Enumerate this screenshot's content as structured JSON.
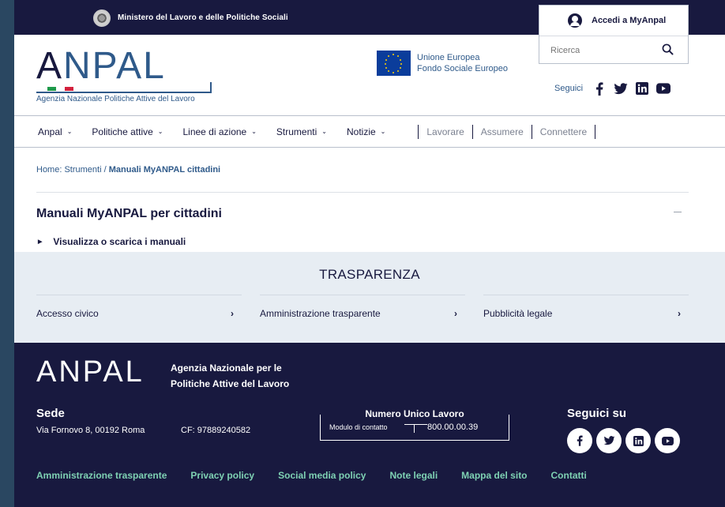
{
  "topbar": {
    "ministry": "Ministero del Lavoro e delle Politiche Sociali"
  },
  "login": {
    "label": "Accedi a MyAnpal"
  },
  "search": {
    "placeholder": "Ricerca"
  },
  "logo": {
    "word": "ANPAL",
    "subtitle": "Agenzia Nazionale Politiche Attive del Lavoro"
  },
  "eu": {
    "line1": "Unione Europea",
    "line2": "Fondo Sociale Europeo"
  },
  "social": {
    "label": "Seguici",
    "icons": [
      "facebook-icon",
      "twitter-icon",
      "linkedin-icon",
      "youtube-icon"
    ]
  },
  "nav": {
    "items": [
      {
        "label": "Anpal"
      },
      {
        "label": "Politiche attive"
      },
      {
        "label": "Linee di azione"
      },
      {
        "label": "Strumenti"
      },
      {
        "label": "Notizie"
      }
    ],
    "links": [
      "Lavorare",
      "Assumere",
      "Connettere"
    ]
  },
  "breadcrumb": {
    "home": "Home:",
    "strumenti": "Strumenti",
    "sep": "/",
    "current": "Manuali MyANPAL cittadini"
  },
  "section": {
    "title": "Manuali MyANPAL per cittadini",
    "accordion": "Visualizza o scarica i manuali"
  },
  "trasparenza": {
    "title": "TRASPARENZA",
    "items": [
      {
        "label": "Accesso civico"
      },
      {
        "label": "Amministrazione trasparente"
      },
      {
        "label": "Pubblicità legale"
      }
    ]
  },
  "footer": {
    "logo": "ANPAL",
    "agency_line1": "Agenzia Nazionale per le",
    "agency_line2": "Politiche Attive del Lavoro",
    "sede_title": "Sede",
    "address": "Via Fornovo 8, 00192 Roma",
    "cf": "CF: 97889240582",
    "numero_title": "Numero Unico Lavoro",
    "modulo": "Modulo di contatto",
    "phone": "800.00.00.39",
    "seguici_title": "Seguici su",
    "links": [
      "Amministrazione trasparente",
      "Privacy policy",
      "Social media policy",
      "Note legali",
      "Mappa del sito",
      "Contatti"
    ]
  },
  "colors": {
    "navy": "#18193f",
    "blue": "#2f5a8a",
    "footer_link": "#7ed1b3",
    "light_bg": "#e7edf3"
  }
}
